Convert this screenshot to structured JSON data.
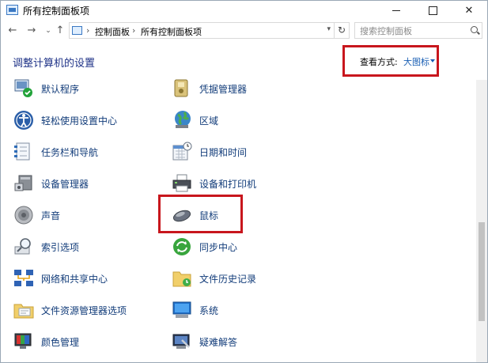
{
  "window": {
    "title": "所有控制面板项"
  },
  "nav": {
    "breadcrumb": [
      "控制面板",
      "所有控制面板项"
    ],
    "search_placeholder": "搜索控制面板"
  },
  "header": {
    "heading": "调整计算机的设置",
    "view_label": "查看方式:",
    "view_value": "大图标"
  },
  "items": [
    {
      "label": "默认程序",
      "icon": "default-programs-icon"
    },
    {
      "label": "凭据管理器",
      "icon": "credential-manager-icon"
    },
    {
      "label": "轻松使用设置中心",
      "icon": "ease-of-access-icon"
    },
    {
      "label": "区域",
      "icon": "region-globe-icon"
    },
    {
      "label": "任务栏和导航",
      "icon": "taskbar-icon"
    },
    {
      "label": "日期和时间",
      "icon": "date-time-icon"
    },
    {
      "label": "设备管理器",
      "icon": "device-manager-icon"
    },
    {
      "label": "设备和打印机",
      "icon": "printer-icon"
    },
    {
      "label": "声音",
      "icon": "speaker-icon"
    },
    {
      "label": "鼠标",
      "icon": "mouse-icon"
    },
    {
      "label": "索引选项",
      "icon": "indexing-icon"
    },
    {
      "label": "同步中心",
      "icon": "sync-center-icon"
    },
    {
      "label": "网络和共享中心",
      "icon": "network-icon"
    },
    {
      "label": "文件历史记录",
      "icon": "file-history-icon"
    },
    {
      "label": "文件资源管理器选项",
      "icon": "folder-options-icon"
    },
    {
      "label": "系统",
      "icon": "system-icon"
    },
    {
      "label": "颜色管理",
      "icon": "color-management-icon"
    },
    {
      "label": "疑难解答",
      "icon": "troubleshooting-icon"
    }
  ],
  "colors": {
    "highlight": "#c8161d",
    "link": "#1a5fb4",
    "heading": "#1e3287"
  }
}
